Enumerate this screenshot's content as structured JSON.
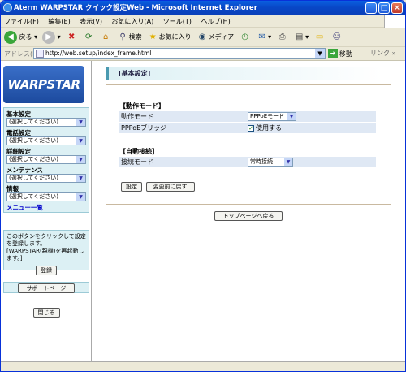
{
  "window": {
    "title": "Aterm WARPSTAR クイック設定Web - Microsoft Internet Explorer"
  },
  "menu": [
    "ファイル(F)",
    "編集(E)",
    "表示(V)",
    "お気に入り(A)",
    "ツール(T)",
    "ヘルプ(H)"
  ],
  "toolbar": {
    "back": "戻る",
    "search": "検索",
    "favorites": "お気に入り",
    "media": "メディア"
  },
  "address": {
    "label": "アドレス(D)",
    "url": "http://web.setup/index_frame.html",
    "go": "移動",
    "links": "リンク"
  },
  "nav": {
    "logo": "WARPSTAR",
    "groups": [
      {
        "label": "基本設定",
        "value": "(選択してください)"
      },
      {
        "label": "電話設定",
        "value": "(選択してください)"
      },
      {
        "label": "詳細設定",
        "value": "(選択してください)"
      },
      {
        "label": "メンテナンス",
        "value": "(選択してください)"
      },
      {
        "label": "情報",
        "value": "(選択してください)"
      }
    ],
    "menu_list": "メニュー一覧",
    "register_text": "このボタンをクリックして設定を登録します。[WARPSTAR(親機)を再起動します。]",
    "register_button": "登録",
    "support_button": "サポートページ",
    "close_button": "閉じる"
  },
  "main": {
    "heading": "[基本設定]",
    "section1": "【動作モード】",
    "row_mode_label": "動作モード",
    "row_mode_value": "PPPoEモード",
    "row_bridge_label": "PPPoEブリッジ",
    "row_bridge_value": "使用する",
    "bridge_checked": true,
    "section2": "【自動接続】",
    "row_conn_label": "接続モード",
    "row_conn_value": "常時接続",
    "set_button": "設定",
    "revert_button": "変更前に戻す",
    "top_button": "トップページへ戻る"
  }
}
